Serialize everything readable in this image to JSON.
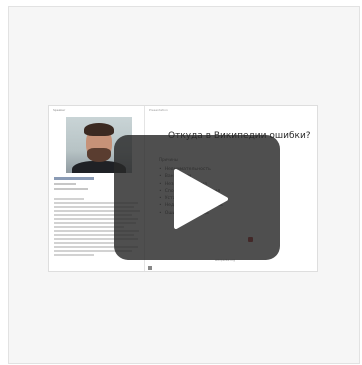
{
  "slide": {
    "left_title": "Speaker",
    "right_title": "Presentation",
    "heading": "Откуда в Википедии ошибки?",
    "subheading": "Причины",
    "bullets": [
      "Невнимательность",
      "Вандализм",
      "Незнание правил",
      "Спорные утверждения",
      "Устаревшие данные",
      "Недостаток источников",
      "Ошибки перевода"
    ],
    "footer": "wikipedia.org"
  },
  "player": {
    "play_label": "Play video"
  },
  "colors": {
    "overlay": "#2d2d2d",
    "accent": "#b52b2b"
  }
}
